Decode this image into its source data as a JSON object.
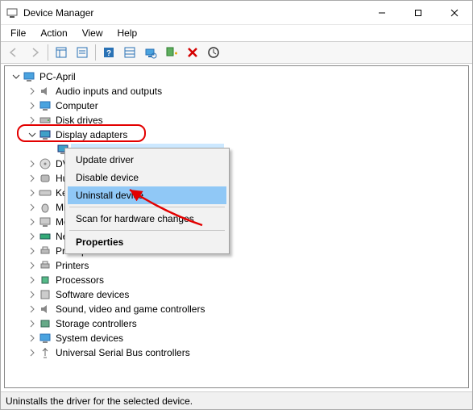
{
  "window": {
    "title": "Device Manager",
    "buttons": {
      "minimize": "—",
      "maximize": "▢",
      "close": "✕"
    }
  },
  "menubar": {
    "file": "File",
    "action": "Action",
    "view": "View",
    "help": "Help"
  },
  "tree": {
    "root": "PC-April",
    "items": {
      "audio": "Audio inputs and outputs",
      "computer": "Computer",
      "disk": "Disk drives",
      "display": "Display adapters",
      "display_child_prefix": "",
      "dvd": "DVD",
      "hid": "Hur",
      "keyboard": "Key",
      "mice": "Mic",
      "monitors": "Mor",
      "network": "Net",
      "print_queues": "Print queues",
      "printers": "Printers",
      "processors": "Processors",
      "software": "Software devices",
      "sound": "Sound, video and game controllers",
      "storage": "Storage controllers",
      "system": "System devices",
      "usb": "Universal Serial Bus controllers"
    }
  },
  "context_menu": {
    "update": "Update driver",
    "disable": "Disable device",
    "uninstall": "Uninstall device",
    "scan": "Scan for hardware changes",
    "properties": "Properties"
  },
  "statusbar": {
    "text": "Uninstalls the driver for the selected device."
  },
  "colors": {
    "highlight_red": "#e30000",
    "context_highlight": "#90c8f6",
    "tree_select": "#cce8ff"
  }
}
